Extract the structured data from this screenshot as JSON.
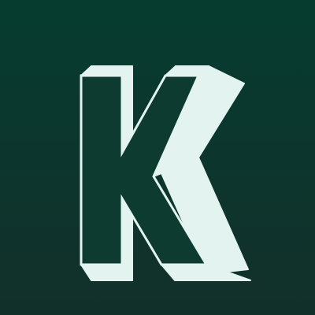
{
  "icon": {
    "letter": "K",
    "style": "3d-outlined-letter",
    "colors": {
      "background_top": "#063c30",
      "background_bottom": "#12302a",
      "extrusion": "#e2f3f0",
      "letter_outline": "#e2f3f0",
      "letter_fill": "#0e3b2f"
    }
  }
}
